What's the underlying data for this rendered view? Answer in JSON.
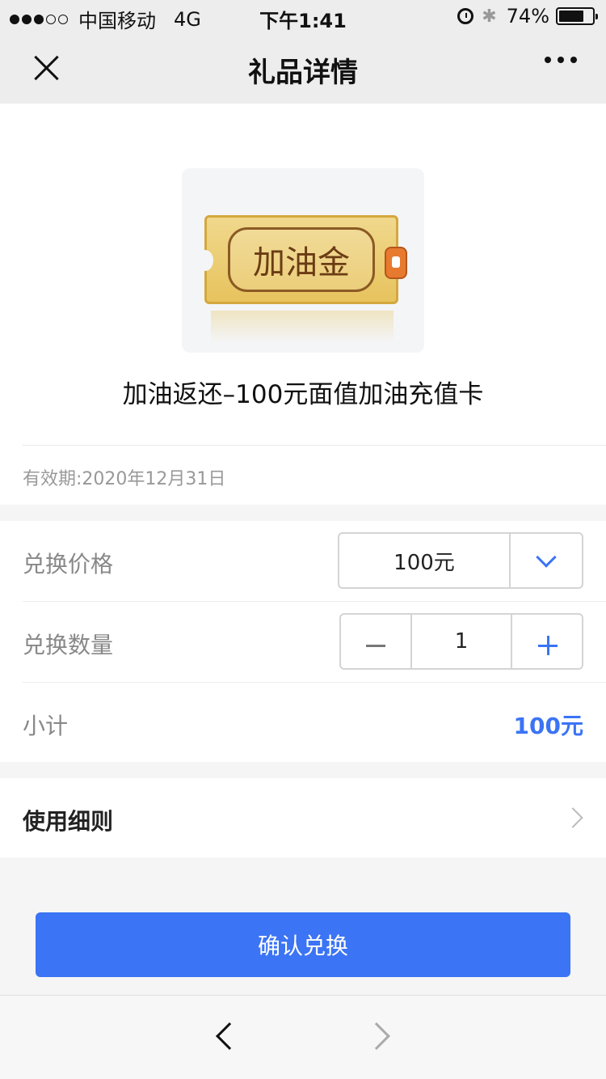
{
  "status_bar": {
    "carrier": "中国移动",
    "network": "4G",
    "time": "下午1:41",
    "battery": "74%",
    "battery_level": 0.74,
    "signal_bars": 3,
    "signal_total": 5
  },
  "nav": {
    "title": "礼品详情"
  },
  "product": {
    "image_text": "加油金",
    "name": "加油返还–100元面值加油充值卡",
    "validity": "有效期:2020年12月31日"
  },
  "options": {
    "price_label": "兑换价格",
    "price_value": "100元",
    "quantity_label": "兑换数量",
    "quantity_value": "1",
    "subtotal_label": "小计",
    "subtotal_value": "100元"
  },
  "rules": {
    "label": "使用细则"
  },
  "confirm_button": "确认兑换",
  "colors": {
    "accent": "#3b74f4",
    "nav_bg": "#ededed",
    "page_bg": "#f5f5f5"
  },
  "icons": [
    "close-icon",
    "more-icon",
    "chevron-down-icon",
    "minus-icon",
    "plus-icon",
    "chevron-right-icon",
    "back-icon",
    "forward-icon",
    "alarm-icon",
    "bluetooth-icon",
    "battery-icon"
  ]
}
